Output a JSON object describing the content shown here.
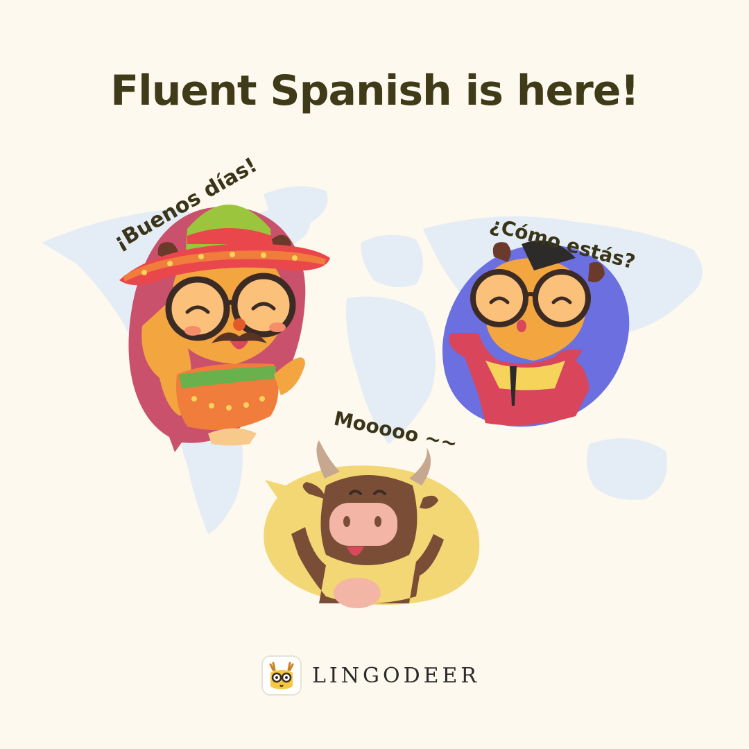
{
  "headline": "Fluent Spanish is here!",
  "greetings": {
    "left": "¡Buenos días!",
    "right": "¿Cómo estás?",
    "bottom": "Mooooo ~~"
  },
  "brand": {
    "name": "LINGODEER",
    "logo_icon": "deer-with-glasses-icon"
  },
  "colors": {
    "background": "#fdf9ef",
    "headline": "#3f3a17",
    "map": "#e4edf5",
    "left_bubble": "#c9516c",
    "right_bubble": "#6b6fe0",
    "bottom_bubble": "#f2d774"
  }
}
